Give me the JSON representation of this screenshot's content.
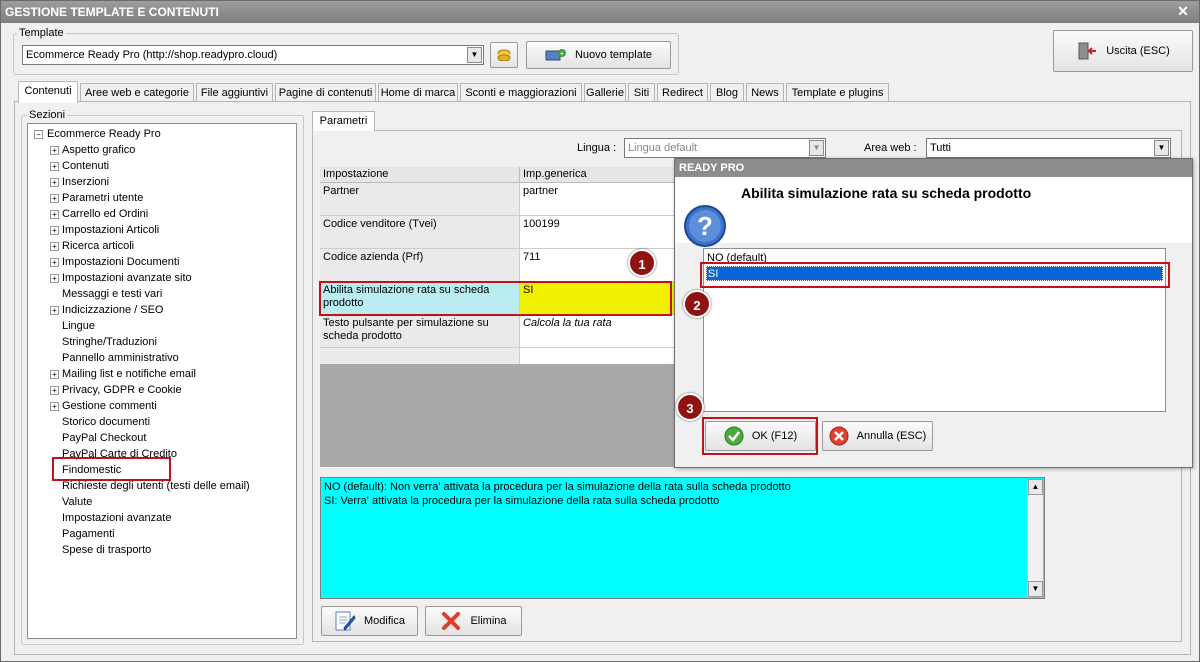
{
  "window": {
    "title": "GESTIONE TEMPLATE E CONTENUTI"
  },
  "template_group": {
    "label": "Template",
    "selected": "Ecommerce Ready Pro (http://shop.readypro.cloud)",
    "new_button": "Nuovo template"
  },
  "exit_button": "Uscita (ESC)",
  "tabs": [
    "Contenuti",
    "Aree web e categorie",
    "File aggiuntivi",
    "Pagine di contenuti",
    "Home di marca",
    "Sconti e maggiorazioni",
    "Gallerie",
    "Siti",
    "Redirect",
    "Blog",
    "News",
    "Template e plugins"
  ],
  "sections": {
    "label": "Sezioni",
    "root": "Ecommerce Ready Pro",
    "items": [
      {
        "label": "Aspetto grafico",
        "expandable": true
      },
      {
        "label": "Contenuti",
        "expandable": true
      },
      {
        "label": "Inserzioni",
        "expandable": true
      },
      {
        "label": "Parametri utente",
        "expandable": true
      },
      {
        "label": "Carrello ed Ordini",
        "expandable": true
      },
      {
        "label": "Impostazioni Articoli",
        "expandable": true
      },
      {
        "label": "Ricerca articoli",
        "expandable": true
      },
      {
        "label": "Impostazioni Documenti",
        "expandable": true
      },
      {
        "label": "Impostazioni avanzate sito",
        "expandable": true
      },
      {
        "label": "Messaggi e testi vari",
        "expandable": false
      },
      {
        "label": "Indicizzazione / SEO",
        "expandable": true
      },
      {
        "label": "Lingue",
        "expandable": false
      },
      {
        "label": "Stringhe/Traduzioni",
        "expandable": false
      },
      {
        "label": "Pannello amministrativo",
        "expandable": false
      },
      {
        "label": "Mailing list e notifiche email",
        "expandable": true
      },
      {
        "label": "Privacy, GDPR e Cookie",
        "expandable": true
      },
      {
        "label": "Gestione commenti",
        "expandable": true
      },
      {
        "label": "Storico documenti",
        "expandable": false
      },
      {
        "label": "PayPal Checkout",
        "expandable": false
      },
      {
        "label": "PayPal Carte di Credito",
        "expandable": false
      },
      {
        "label": "Findomestic",
        "expandable": false
      },
      {
        "label": "Richieste degli utenti (testi delle email)",
        "expandable": false
      },
      {
        "label": "Valute",
        "expandable": false
      },
      {
        "label": "Impostazioni avanzate",
        "expandable": false
      },
      {
        "label": "Pagamenti",
        "expandable": false
      },
      {
        "label": "Spese di trasporto",
        "expandable": false
      }
    ]
  },
  "params": {
    "tab": "Parametri",
    "lingua_label": "Lingua :",
    "lingua_value": "Lingua default",
    "area_label": "Area web :",
    "area_value": "Tutti",
    "columns": [
      "Impostazione",
      "Imp.generica"
    ],
    "rows": [
      {
        "setting": "Partner",
        "value": "partner"
      },
      {
        "setting": "Codice venditore (Tvei)",
        "value": "100199"
      },
      {
        "setting": "Codice azienda (Prf)",
        "value": "711"
      },
      {
        "setting": "Abilita simulazione rata su scheda prodotto",
        "value": "SI"
      },
      {
        "setting": "Testo pulsante per simulazione su scheda prodotto",
        "value": "Calcola la tua rata"
      }
    ]
  },
  "description": {
    "line1": "NO (default): Non verra' attivata la procedura per la simulazione della rata sulla scheda prodotto",
    "line2": "SI: Verra' attivata la procedura per la  simulazione della rata sulla scheda prodotto"
  },
  "bottom_buttons": {
    "edit": "Modifica",
    "delete": "Elimina"
  },
  "dialog": {
    "title": "READY PRO",
    "question": "Abilita simulazione rata su scheda prodotto",
    "options": [
      "NO (default)",
      "SI"
    ],
    "selected_index": 1,
    "ok": "OK (F12)",
    "cancel": "Annulla (ESC)"
  },
  "callouts": [
    "1",
    "2",
    "3"
  ],
  "colors": {
    "highlight_red": "#c0121a",
    "selection_blue": "#0a64d6",
    "cell_yellow": "#f0f000",
    "cell_cyan": "#b8ecf0",
    "desc_cyan": "#00ffff",
    "badge": "#8e1414"
  }
}
